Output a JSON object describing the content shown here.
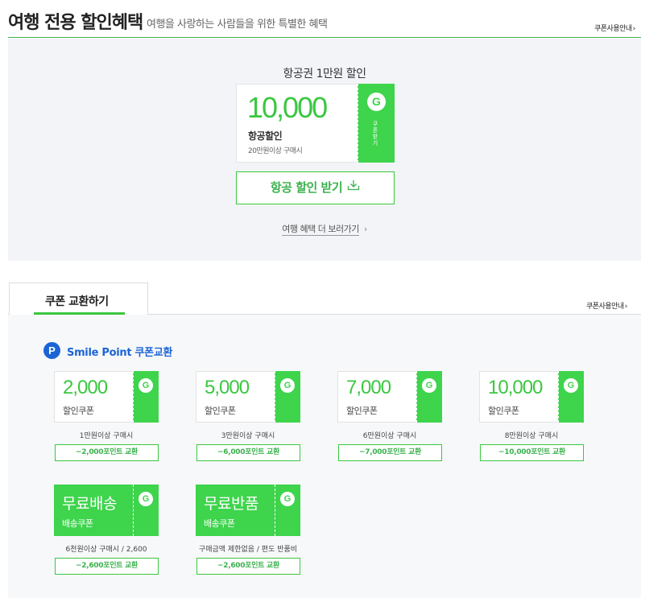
{
  "header": {
    "title": "여행 전용 할인혜택",
    "subtitle": "여행을 사랑하는 사람들을 위한 특별한 혜택",
    "guide_link": "쿠폰사용안내"
  },
  "flight": {
    "title": "항공권 1만원 할인",
    "coupon": {
      "amount": "10,000",
      "label": "항공할인",
      "condition": "20만원이상 구매시",
      "stub_letter": "G",
      "stub_text": "쿠폰받기"
    },
    "download_label": "항공 할인 받기",
    "more_link": "여행 혜택 더 보러가기"
  },
  "exchange": {
    "tab_label": "쿠폰 교환하기",
    "guide_link": "쿠폰사용안내",
    "smile_point_title": "Smile Point 쿠폰교환",
    "p_icon_letter": "P",
    "coupons": [
      {
        "amount": "2,000",
        "label": "할인쿠폰",
        "condition": "1만원이상 구매시",
        "button": "−2,000포인트 교환",
        "green": false
      },
      {
        "amount": "5,000",
        "label": "할인쿠폰",
        "condition": "3만원이상 구매시",
        "button": "−6,000포인트 교환",
        "green": false
      },
      {
        "amount": "7,000",
        "label": "할인쿠폰",
        "condition": "6만원이상 구매시",
        "button": "−7,000포인트 교환",
        "green": false
      },
      {
        "amount": "10,000",
        "label": "할인쿠폰",
        "condition": "8만원이상 구매시",
        "button": "−10,000포인트 교환",
        "green": false
      },
      {
        "amount": "무료배송",
        "label": "배송쿠폰",
        "condition": "6천원이상 구매시 / 2,600",
        "button": "−2,600포인트 교환",
        "green": true
      },
      {
        "amount": "무료반품",
        "label": "배송쿠폰",
        "condition": "구매금액 제한없음 / 편도 반품비",
        "button": "−2,600포인트 교환",
        "green": true
      }
    ],
    "stub_letter": "G"
  },
  "colors": {
    "green": "#3ed44c",
    "green_text": "#3bb24d",
    "blue": "#1a64d6",
    "panel_bg": "#f2f4f8"
  }
}
